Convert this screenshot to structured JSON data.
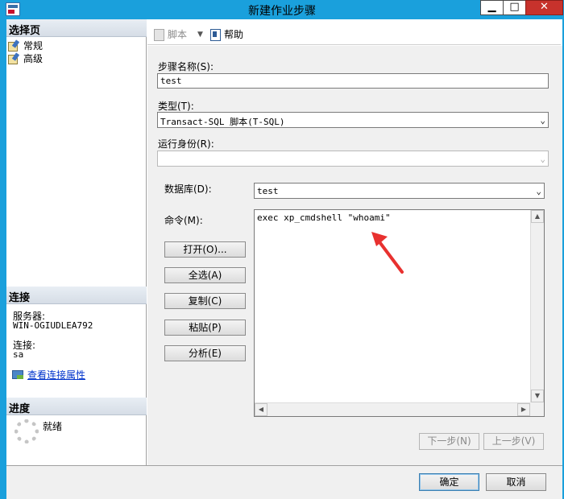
{
  "window": {
    "title": "新建作业步骤",
    "min": "▁",
    "max": "□",
    "close": "✕"
  },
  "sidebar": {
    "select_page_header": "选择页",
    "pages": [
      {
        "label": "常规",
        "icon": "general-page-icon"
      },
      {
        "label": "高级",
        "icon": "advanced-page-icon"
      }
    ],
    "connection_header": "连接",
    "server_label": "服务器:",
    "server_value": "WIN-OGIUDLEA792",
    "connection_label": "连接:",
    "connection_value": "sa",
    "view_properties_link": "查看连接属性",
    "progress_header": "进度",
    "progress_status": "就绪"
  },
  "toolbar": {
    "script_label": "脚本",
    "help_label": "帮助"
  },
  "form": {
    "step_name_label": "步骤名称(S):",
    "step_name_value": "test",
    "type_label": "类型(T):",
    "type_value": "Transact-SQL 脚本(T-SQL)",
    "run_as_label": "运行身份(R):",
    "run_as_value": "",
    "database_label": "数据库(D):",
    "database_value": "test",
    "command_label": "命令(M):",
    "command_value": "exec xp_cmdshell \"whoami\""
  },
  "command_buttons": {
    "open": "打开(O)...",
    "select_all": "全选(A)",
    "copy": "复制(C)",
    "paste": "粘贴(P)",
    "parse": "分析(E)"
  },
  "nav_buttons": {
    "next": "下一步(N)",
    "previous": "上一步(V)"
  },
  "dialog_buttons": {
    "ok": "确定",
    "cancel": "取消"
  },
  "colors": {
    "titlebar": "#1aa0dc",
    "close_button": "#c7322c",
    "annotation_arrow": "#e8312f",
    "link": "#0033cc"
  }
}
